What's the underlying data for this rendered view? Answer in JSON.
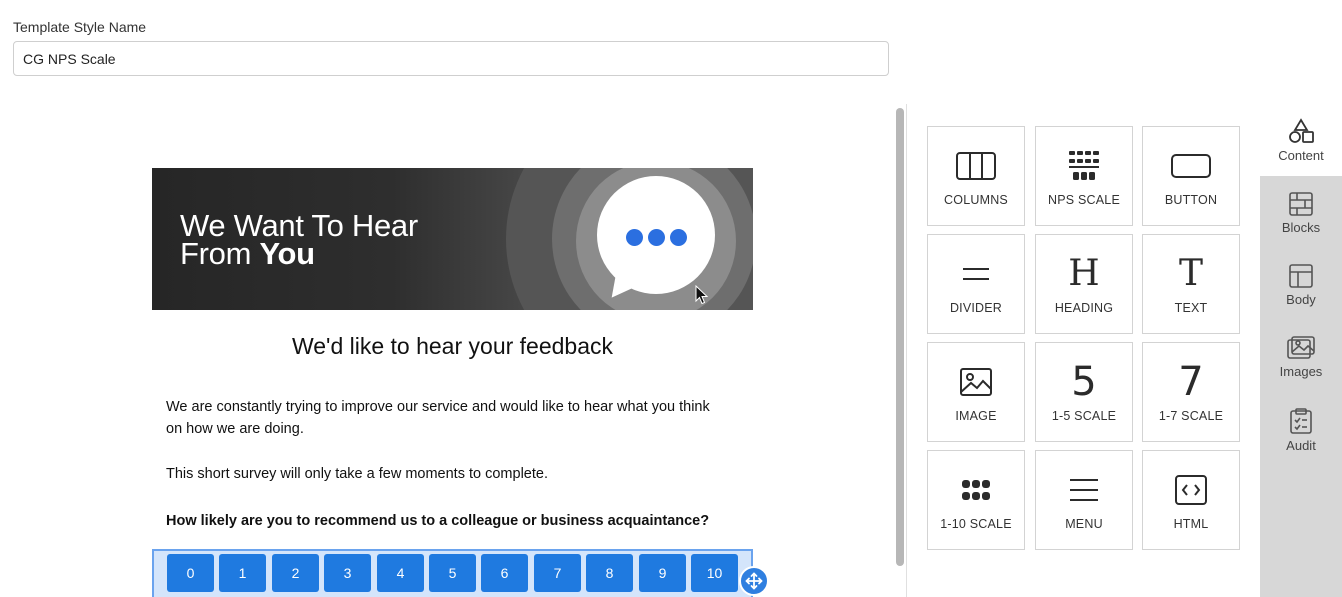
{
  "template_name": {
    "label": "Template Style Name",
    "value": "CG NPS Scale"
  },
  "email": {
    "banner": {
      "line1": "We Want To Hear",
      "line2_prefix": "From ",
      "line2_bold": "You"
    },
    "headline": "We'd like to hear your feedback",
    "paragraph1": "We are constantly trying to improve our service and would like to hear what you think on how we are doing.",
    "paragraph2": "This short survey will only take a few moments to complete.",
    "question": "How likely are you to recommend us to a colleague or business acquaintance?",
    "scale": [
      "0",
      "1",
      "2",
      "3",
      "4",
      "5",
      "6",
      "7",
      "8",
      "9",
      "10"
    ]
  },
  "tools": [
    {
      "label": "COLUMNS",
      "icon": "columns-icon"
    },
    {
      "label": "NPS SCALE",
      "icon": "nps-scale-icon"
    },
    {
      "label": "BUTTON",
      "icon": "button-icon"
    },
    {
      "label": "DIVIDER",
      "icon": "divider-icon"
    },
    {
      "label": "HEADING",
      "icon": "heading-icon",
      "glyph": "H"
    },
    {
      "label": "TEXT",
      "icon": "text-icon",
      "glyph": "T"
    },
    {
      "label": "IMAGE",
      "icon": "image-icon"
    },
    {
      "label": "1-5 SCALE",
      "icon": "scale-5-icon",
      "glyph": "5"
    },
    {
      "label": "1-7 SCALE",
      "icon": "scale-7-icon",
      "glyph": "7"
    },
    {
      "label": "1-10 SCALE",
      "icon": "scale-10-icon"
    },
    {
      "label": "MENU",
      "icon": "menu-icon"
    },
    {
      "label": "HTML",
      "icon": "html-icon"
    }
  ],
  "sidetabs": [
    {
      "label": "Content",
      "icon": "shapes-icon",
      "active": true
    },
    {
      "label": "Blocks",
      "icon": "blocks-icon",
      "active": false
    },
    {
      "label": "Body",
      "icon": "layout-icon",
      "active": false
    },
    {
      "label": "Images",
      "icon": "images-icon",
      "active": false
    },
    {
      "label": "Audit",
      "icon": "clipboard-icon",
      "active": false
    }
  ],
  "colors": {
    "accent": "#1f7ae0",
    "selection": "#d4e5fb",
    "sidebar": "#d7d7d7",
    "banner_dot": "#2b6fe0"
  }
}
